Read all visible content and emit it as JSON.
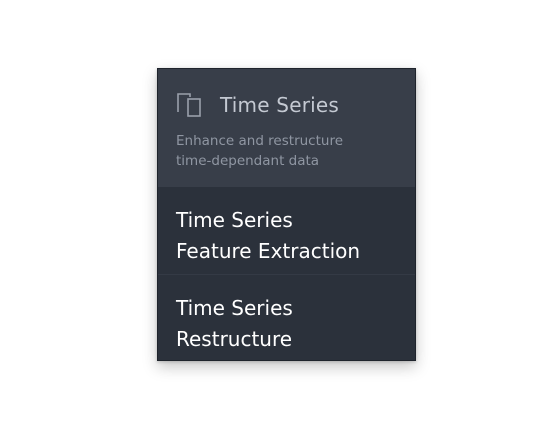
{
  "menu": {
    "header": {
      "icon": "copy-icon",
      "title": "Time Series",
      "description": "Enhance and restructure\ntime-dependant data"
    },
    "items": [
      {
        "label": "Time Series\nFeature Extraction"
      },
      {
        "label": "Time Series\nRestructure"
      }
    ]
  },
  "colors": {
    "header_background": "#383e49",
    "menu_background": "#2b313b",
    "title_text": "#c4c9d2",
    "description_text": "#8f96a2",
    "item_text": "#ffffff"
  }
}
